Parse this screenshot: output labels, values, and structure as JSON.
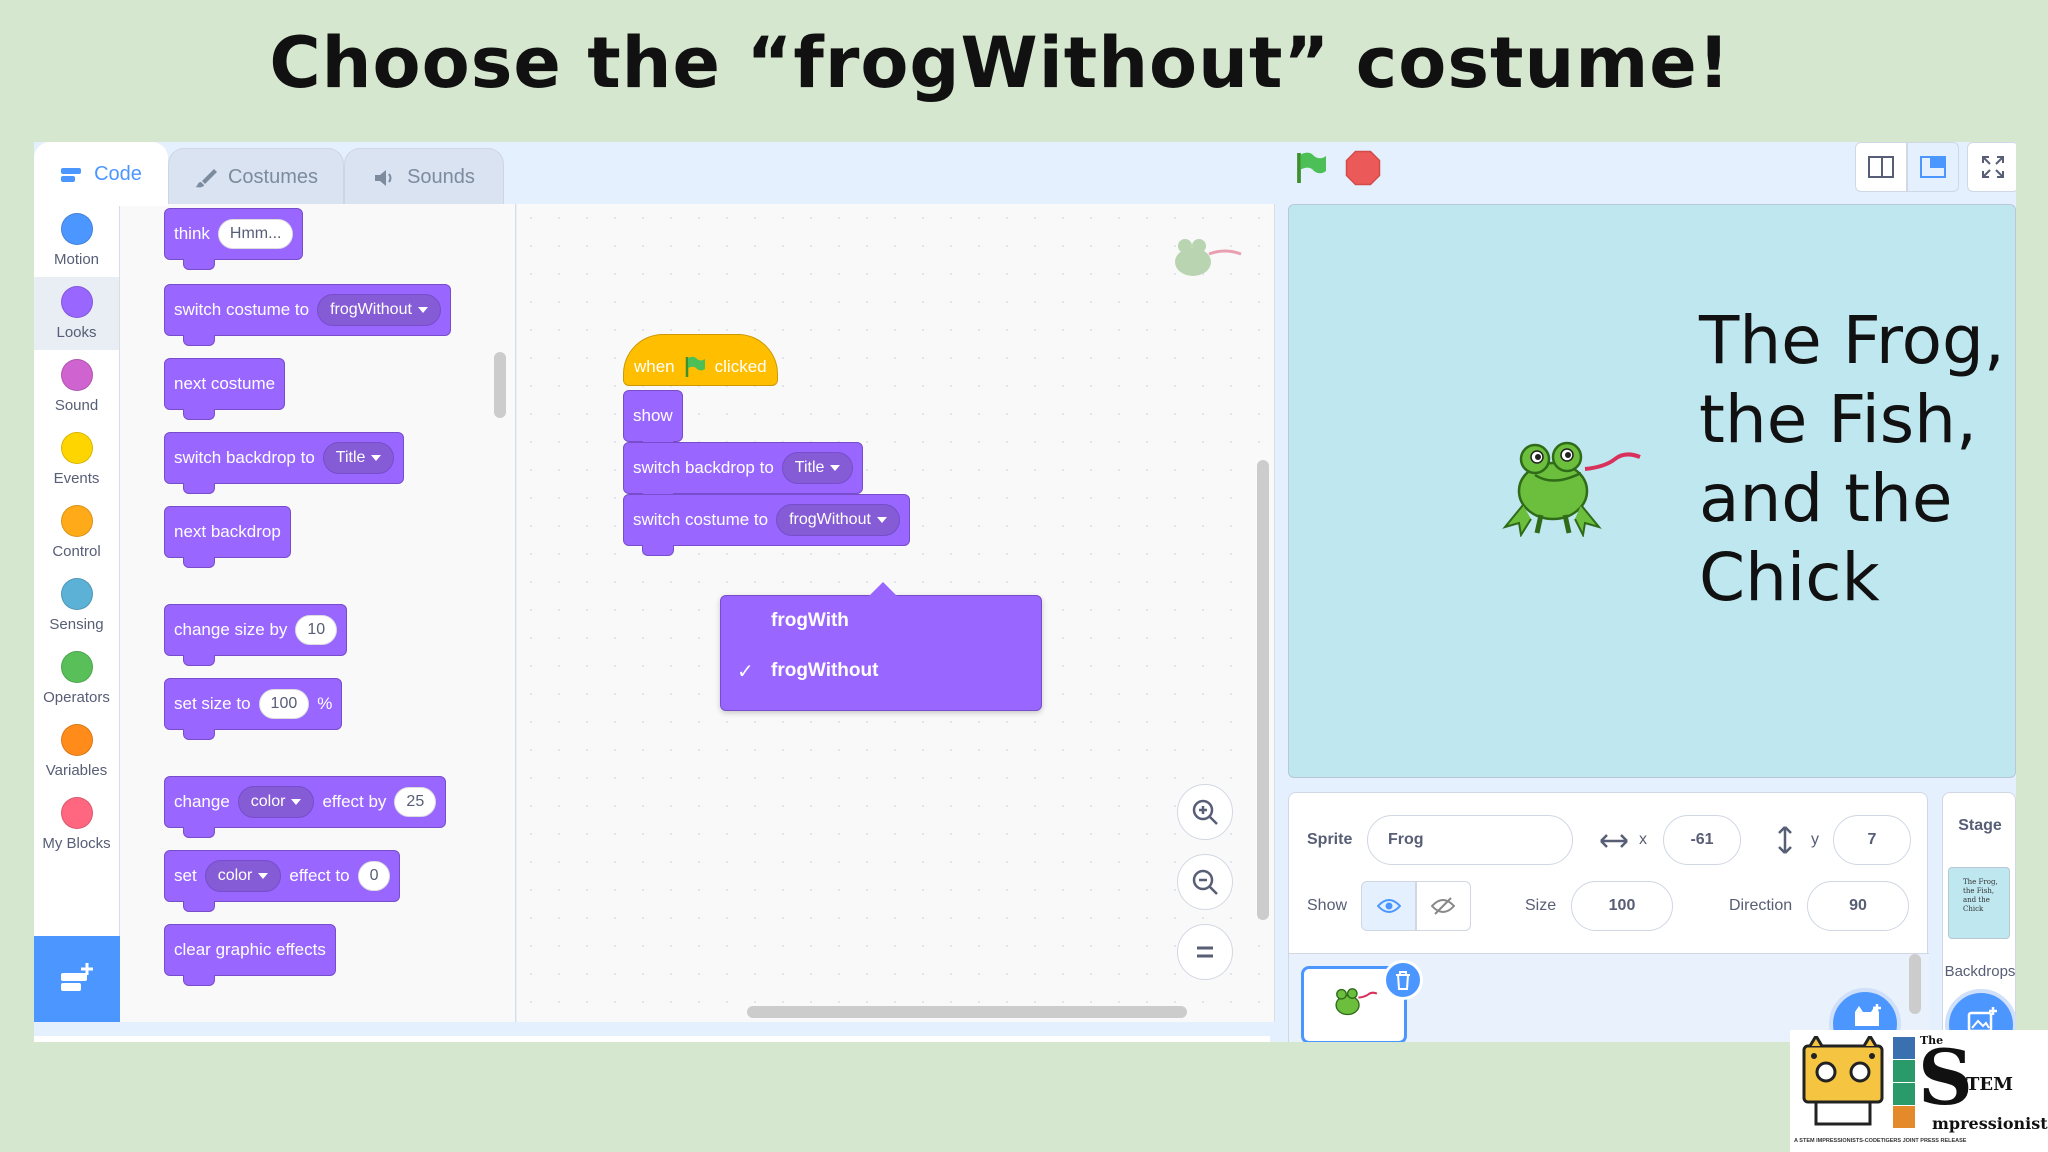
{
  "slide": {
    "title": "Choose the “frogWithout” costume!"
  },
  "tabs": [
    {
      "label": "Code",
      "icon": "code-blocks-icon",
      "active": true
    },
    {
      "label": "Costumes",
      "icon": "paintbrush-icon",
      "active": false
    },
    {
      "label": "Sounds",
      "icon": "speaker-icon",
      "active": false
    }
  ],
  "categories": [
    {
      "label": "Motion",
      "color": "#4c97ff"
    },
    {
      "label": "Looks",
      "color": "#9966ff",
      "selected": true
    },
    {
      "label": "Sound",
      "color": "#cf63cf"
    },
    {
      "label": "Events",
      "color": "#ffd500"
    },
    {
      "label": "Control",
      "color": "#ffab19"
    },
    {
      "label": "Sensing",
      "color": "#5cb1d6"
    },
    {
      "label": "Operators",
      "color": "#59c059"
    },
    {
      "label": "Variables",
      "color": "#ff8c1a"
    },
    {
      "label": "My Blocks",
      "color": "#ff6680"
    }
  ],
  "palette": {
    "think": {
      "label": "think",
      "value": "Hmm..."
    },
    "switch_costume": {
      "label": "switch costume to",
      "value": "frogWithout"
    },
    "next_costume": {
      "label": "next costume"
    },
    "switch_backdrop": {
      "label": "switch backdrop to",
      "value": "Title"
    },
    "next_backdrop": {
      "label": "next backdrop"
    },
    "change_size": {
      "label": "change size by",
      "value": "10"
    },
    "set_size": {
      "label": "set size to",
      "value": "100",
      "suffix": "%"
    },
    "change_effect": {
      "label": "change",
      "effect": "color",
      "mid": "effect by",
      "value": "25"
    },
    "set_effect": {
      "label": "set",
      "effect": "color",
      "mid": "effect to",
      "value": "0"
    },
    "clear_effects": {
      "label": "clear graphic effects"
    }
  },
  "script": {
    "hat_when": "when",
    "hat_clicked": "clicked",
    "show": "show",
    "switch_backdrop": {
      "label": "switch backdrop to",
      "value": "Title"
    },
    "switch_costume": {
      "label": "switch costume to",
      "value": "frogWithout"
    }
  },
  "costume_menu": {
    "options": [
      "frogWith",
      "frogWithout"
    ],
    "selected": "frogWithout",
    "check_mark": "✓"
  },
  "stage": {
    "title_text_lines": [
      "The Frog,",
      "the Fish,",
      "and the",
      "Chick"
    ]
  },
  "sprite_info": {
    "sprite_label": "Sprite",
    "sprite_name": "Frog",
    "x_label": "x",
    "x": "-61",
    "y_label": "y",
    "y": "7",
    "show_label": "Show",
    "size_label": "Size",
    "size": "100",
    "direction_label": "Direction",
    "direction": "90"
  },
  "stage_pane": {
    "label": "Stage",
    "thumb_text": "The Frog, the Fish, and the Chick",
    "backdrops_label": "Backdrops"
  },
  "logo": {
    "text_top": "The",
    "text_main": "TEM",
    "text_sub": "mpressionists",
    "tagline": "A STEM IMPRESSIONISTS-CODETIGERS JOINT PRESS RELEASE"
  },
  "colors": {
    "looks": "#9966ff",
    "events": "#ffbf00",
    "accent": "#4c97ff",
    "background": "#d6e7cf"
  }
}
